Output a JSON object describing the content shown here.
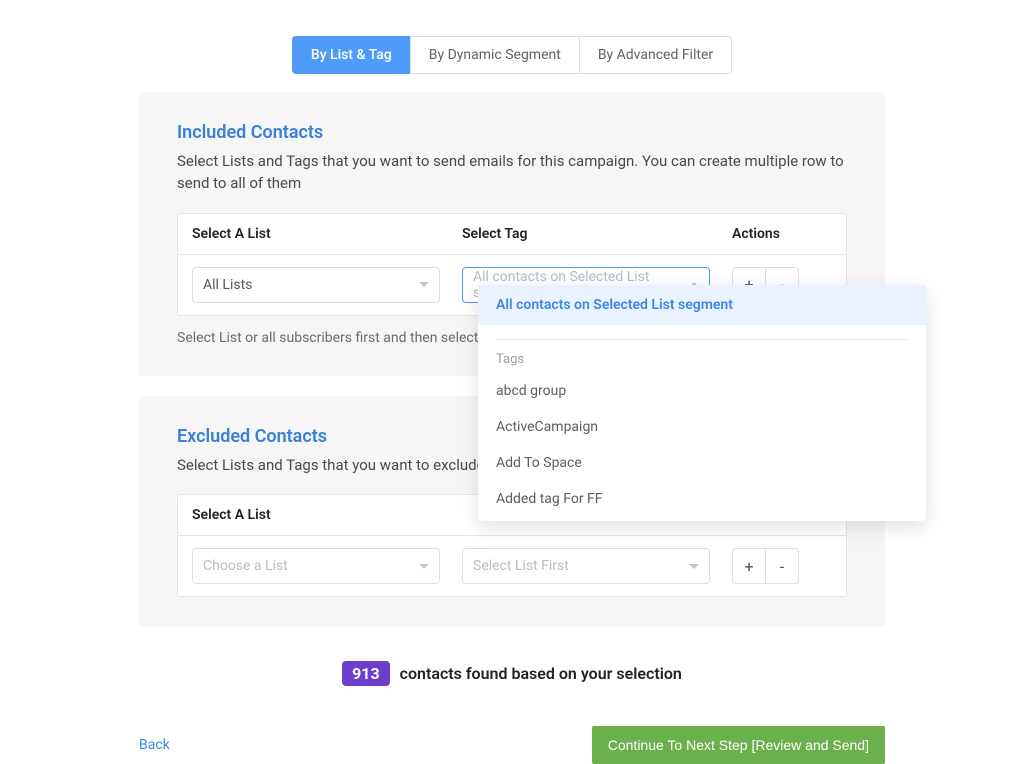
{
  "tabs": {
    "by_list_tag": "By List & Tag",
    "by_dynamic_segment": "By Dynamic Segment",
    "by_advanced_filter": "By Advanced Filter"
  },
  "included": {
    "title": "Included Contacts",
    "desc": "Select Lists and Tags that you want to send emails for this campaign. You can create multiple row to send to all of them",
    "col_list": "Select A List",
    "col_tag": "Select Tag",
    "col_actions": "Actions",
    "row1": {
      "list_value": "All Lists",
      "tag_placeholder": "All contacts on Selected List segment",
      "add_label": "+",
      "remove_label": "-"
    },
    "hint": "Select List or all subscribers first and then select tag"
  },
  "excluded": {
    "title": "Excluded Contacts",
    "desc": "Select Lists and Tags that you want to exclude from your included selection",
    "col_list": "Select A List",
    "row1": {
      "list_placeholder": "Choose a List",
      "tag_placeholder": "Select List First",
      "add_label": "+",
      "remove_label": "-"
    }
  },
  "tag_dropdown": {
    "selected": "All contacts on Selected List segment",
    "group_label": "Tags",
    "options": [
      "abcd group",
      "ActiveCampaign",
      "Add To Space",
      "Added tag For FF"
    ]
  },
  "footer": {
    "count": "913",
    "count_text": "contacts found based on your selection",
    "back": "Back",
    "continue": "Continue To Next Step [Review and Send]"
  }
}
